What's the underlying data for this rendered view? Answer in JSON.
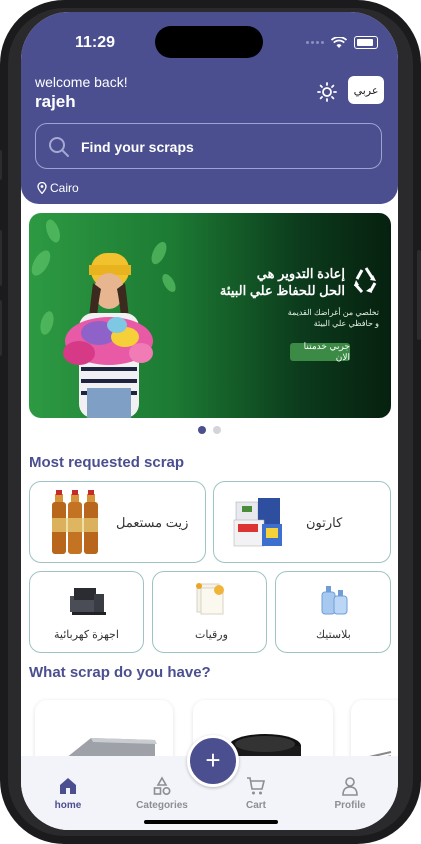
{
  "status_bar": {
    "time": "11:29"
  },
  "header": {
    "welcome": "welcome back!",
    "username": "rajeh",
    "language_button": "عربي",
    "search_placeholder": "Find your scraps",
    "location": "Cairo",
    "accent_color": "#4b4f8f"
  },
  "banner": {
    "title_line1": "إعادة التدوير هي",
    "title_line2": "الحل للحفاظ علي البيئة",
    "subtitle_line1": "تخلصي من أغراضك القديمة",
    "subtitle_line2": "و حافظي علي البيئة",
    "cta": "جربي خدمتنا الان",
    "active_slide": 1,
    "slide_count": 2
  },
  "most_requested": {
    "title": "Most requested scrap",
    "items": [
      {
        "label": "زيت مستعمل",
        "icon": "oil-bottles-icon"
      },
      {
        "label": "كارتون",
        "icon": "cartons-icon"
      },
      {
        "label": "اجهزة كهربائية",
        "icon": "appliances-icon"
      },
      {
        "label": "ورقيات",
        "icon": "paper-icon"
      },
      {
        "label": "بلاستيك",
        "icon": "plastic-bottles-icon"
      }
    ]
  },
  "what_scrap": {
    "title": "What scrap do you have?"
  },
  "bottom_nav": {
    "items": [
      {
        "label": "home",
        "icon": "home-icon",
        "active": true
      },
      {
        "label": "Categories",
        "icon": "categories-icon",
        "active": false
      },
      {
        "label": "Cart",
        "icon": "cart-icon",
        "active": false
      },
      {
        "label": "Profile",
        "icon": "profile-icon",
        "active": false
      }
    ],
    "fab": "+"
  }
}
